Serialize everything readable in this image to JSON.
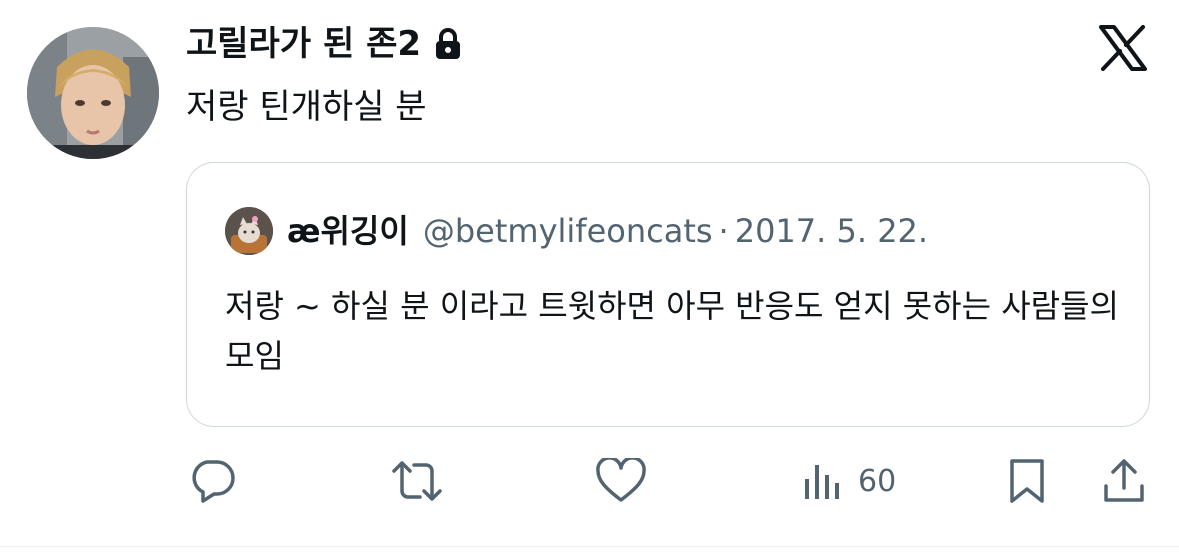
{
  "author": {
    "display_name": "고릴라가 된 존2",
    "avatar_icon": "avatar-photo",
    "protected_icon": "lock-icon"
  },
  "brand_icon": "x-logo-icon",
  "tweet": {
    "text": "저랑 틴개하실 분"
  },
  "quoted_tweet": {
    "display_name": "æ위깅이",
    "handle": "@betmylifeoncats",
    "separator": "·",
    "date": "2017. 5. 22.",
    "text": "저랑 ~ 하실 분 이라고 트윗하면 아무 반응도 얻지 못하는 사람들의 모임"
  },
  "actions": {
    "reply_icon": "reply-icon",
    "retweet_icon": "retweet-icon",
    "like_icon": "heart-icon",
    "views_icon": "views-chart-icon",
    "views_count": "60",
    "bookmark_icon": "bookmark-icon",
    "share_icon": "share-icon"
  },
  "colors": {
    "text_primary": "#0f1419",
    "text_secondary": "#536471",
    "border": "#cfd9de"
  }
}
